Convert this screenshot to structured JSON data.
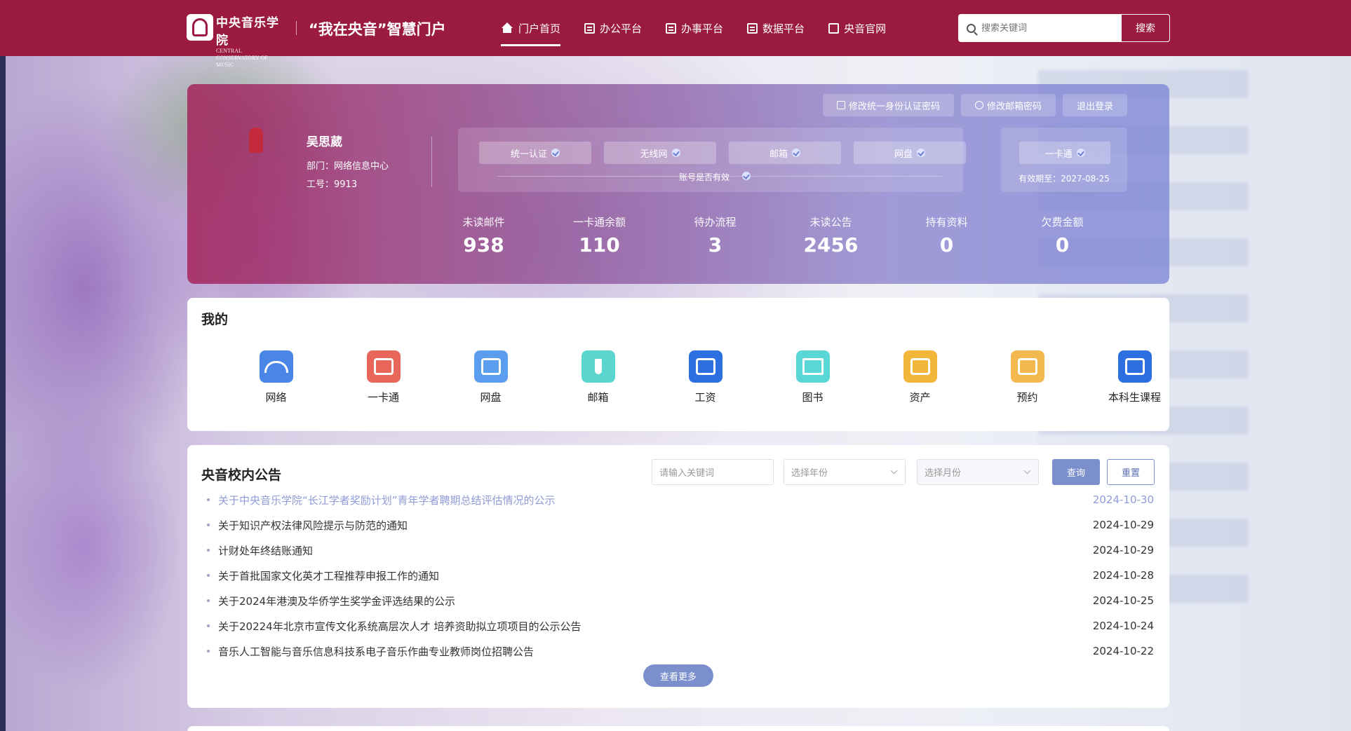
{
  "header": {
    "school_cn": "中央音乐学院",
    "school_en": "CENTRAL CONSERVATORY OF MUSIC",
    "portal_name": "“我在央音”智慧门户",
    "nav": [
      {
        "label": "门户首页",
        "icon": "home-icon"
      },
      {
        "label": "办公平台",
        "icon": "document-icon"
      },
      {
        "label": "办事平台",
        "icon": "edit-document-icon"
      },
      {
        "label": "数据平台",
        "icon": "data-icon"
      },
      {
        "label": "央音官网",
        "icon": "heart-box-icon"
      }
    ],
    "search_placeholder": "搜索关键词",
    "search_button": "搜索"
  },
  "profile": {
    "buttons": {
      "change_password": "修改统一身份认证密码",
      "change_mail_password": "修改邮箱密码",
      "logout": "退出登录"
    },
    "name": "吴思葳",
    "dept": "部门：网络信息中心",
    "staff_id": "工号：9913",
    "accounts": [
      "统一认证",
      "无线网",
      "邮箱",
      "网盘"
    ],
    "account_status": "账号是否有效",
    "card_label": "一卡通",
    "card_valid": "有效期至：2027-08-25",
    "stats": [
      {
        "label": "未读邮件",
        "value": "938"
      },
      {
        "label": "一卡通余额",
        "value": "110"
      },
      {
        "label": "待办流程",
        "value": "3"
      },
      {
        "label": "未读公告",
        "value": "2456"
      },
      {
        "label": "持有资料",
        "value": "0"
      },
      {
        "label": "欠费金额",
        "value": "0"
      }
    ]
  },
  "mine": {
    "title": "我的",
    "apps": [
      {
        "label": "网络",
        "icon": "wifi-icon",
        "color": "#4a86e8"
      },
      {
        "label": "一卡通",
        "icon": "card-icon",
        "color": "#e8665a"
      },
      {
        "label": "网盘",
        "icon": "disk-icon",
        "color": "#5b9ef0"
      },
      {
        "label": "邮箱",
        "icon": "mail-vase-icon",
        "color": "#5ad6cf"
      },
      {
        "label": "工资",
        "icon": "money-bag-icon",
        "color": "#2d6fe0"
      },
      {
        "label": "图书",
        "icon": "book-icon",
        "color": "#5ad6d6"
      },
      {
        "label": "资产",
        "icon": "asset-icon",
        "color": "#f2b63a"
      },
      {
        "label": "预约",
        "icon": "reservation-icon",
        "color": "#f3b94e"
      },
      {
        "label": "本科生课程",
        "icon": "course-icon",
        "color": "#2d6fe0"
      }
    ]
  },
  "notices": {
    "title": "央音校内公告",
    "keyword_placeholder": "请输入关键词",
    "year_placeholder": "选择年份",
    "month_placeholder": "选择月份",
    "query": "查询",
    "reset": "重置",
    "more": "查看更多",
    "items": [
      {
        "text": "关于中央音乐学院“长江学者奖励计划”青年学者聘期总结评估情况的公示",
        "date": "2024-10-30"
      },
      {
        "text": "关于知识产权法律风险提示与防范的通知",
        "date": "2024-10-29"
      },
      {
        "text": "计财处年终结账通知",
        "date": "2024-10-29"
      },
      {
        "text": "关于首批国家文化英才工程推荐申报工作的通知",
        "date": "2024-10-28"
      },
      {
        "text": "关于2024年港澳及华侨学生奖学金评选结果的公示",
        "date": "2024-10-25"
      },
      {
        "text": "关于20224年北京市宣传文化系统高层次人才 培养资助拟立项项目的公示公告",
        "date": "2024-10-24"
      },
      {
        "text": "音乐人工智能与音乐信息科技系电子音乐作曲专业教师岗位招聘公告",
        "date": "2024-10-22"
      }
    ]
  }
}
